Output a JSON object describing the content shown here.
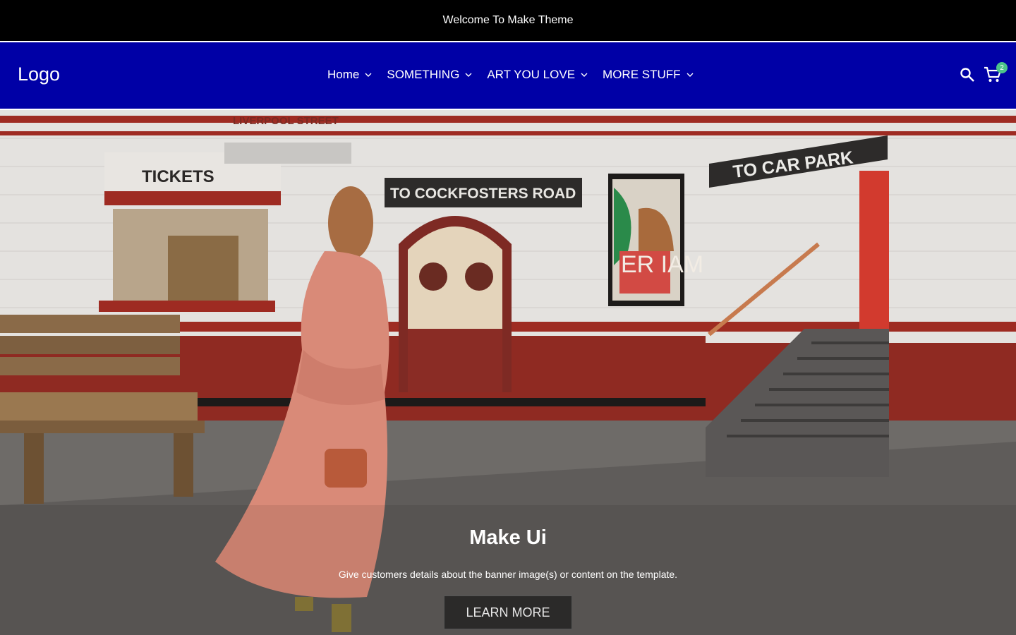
{
  "announcement": {
    "text": "Welcome To Make Theme"
  },
  "header": {
    "logo": "Logo",
    "nav": [
      {
        "label": "Home"
      },
      {
        "label": "SOMETHING"
      },
      {
        "label": "ART YOU LOVE"
      },
      {
        "label": "MORE STUFF"
      }
    ],
    "cart_count": "2"
  },
  "hero": {
    "title": "Make Ui",
    "subtitle": "Give customers details about the banner image(s) or content on the template.",
    "button_label": "LEARN MORE",
    "image_signs": {
      "station": "LIVERPOOL STREET",
      "tickets": "TICKETS",
      "direction": "TO COCKFOSTERS ROAD",
      "car_park": "TO CAR PARK",
      "poster": "ER IAM"
    }
  },
  "colors": {
    "announcement_bg": "#000000",
    "header_bg": "#0000a6",
    "cart_badge": "#4cc38a",
    "button_bg": "#2b2a29"
  }
}
